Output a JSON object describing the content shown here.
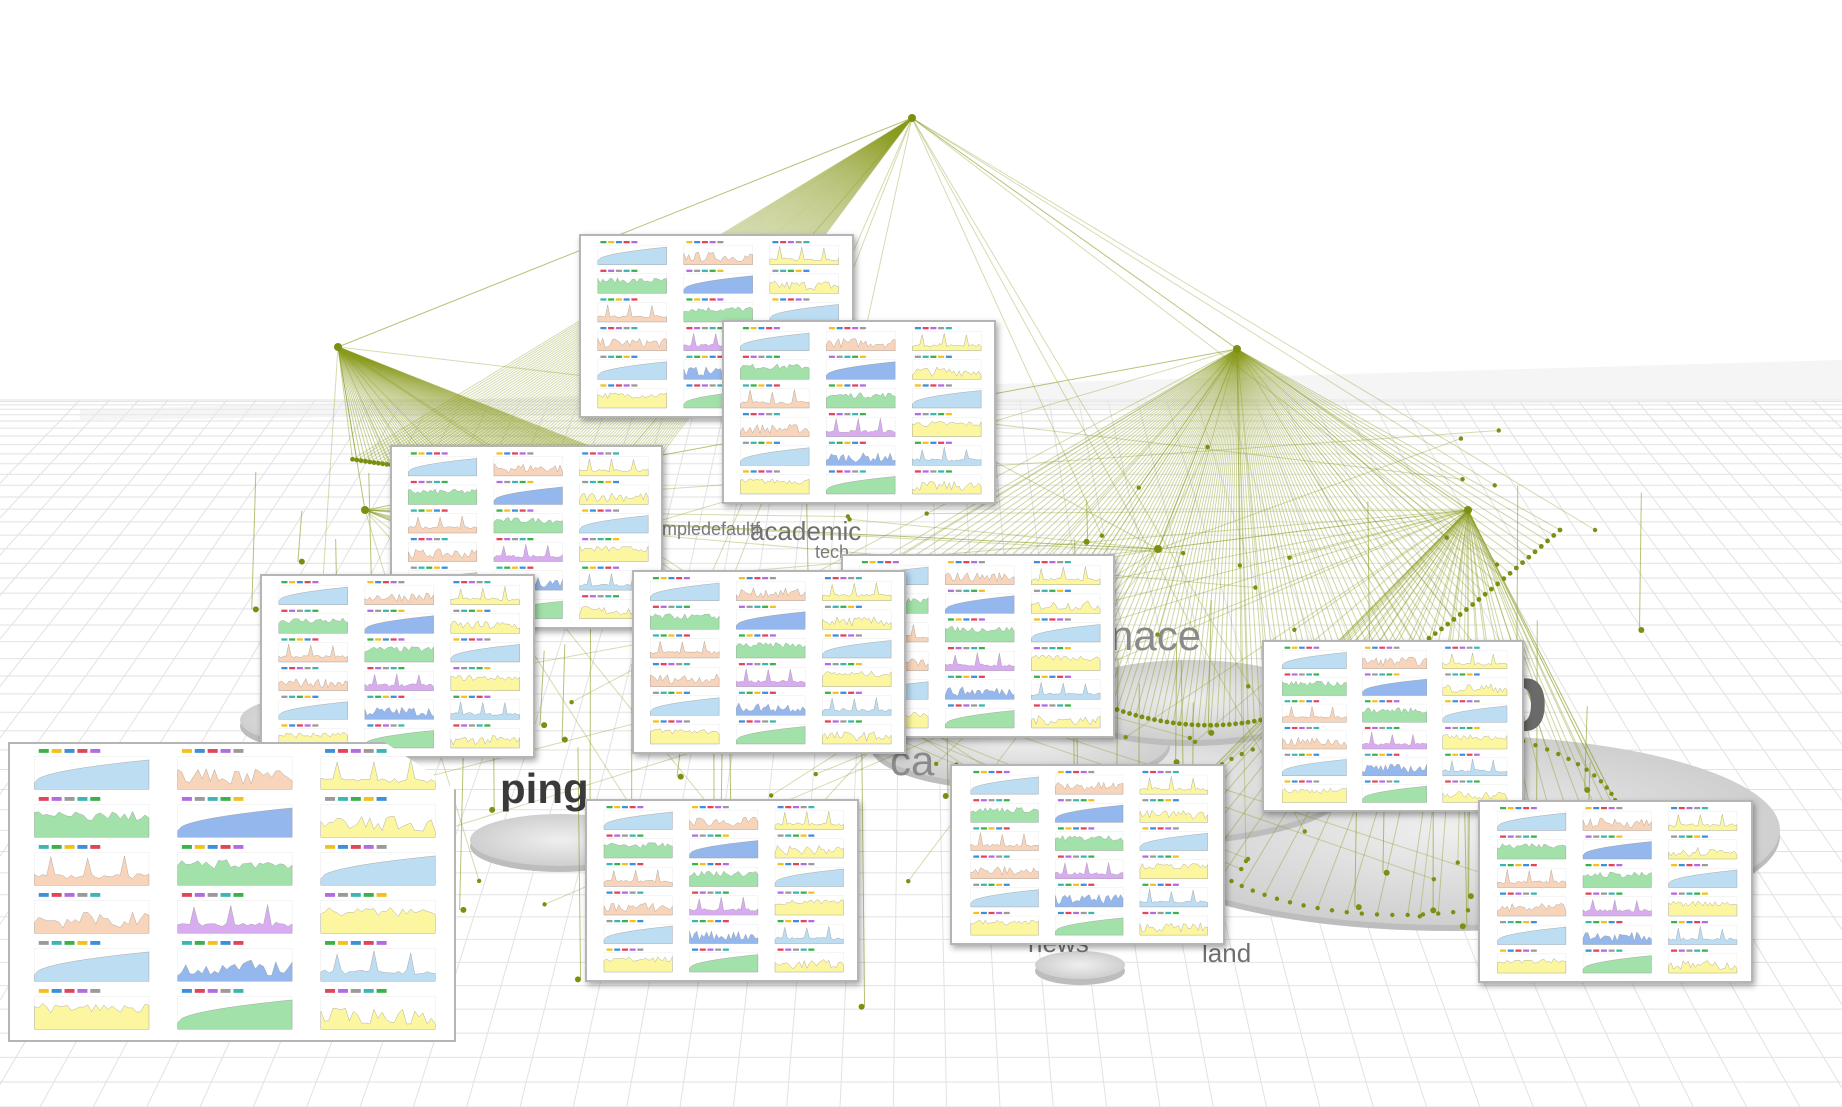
{
  "labels": [
    {
      "id": "label-b",
      "text": "b"
    },
    {
      "id": "label-nace",
      "text": "nace"
    },
    {
      "id": "label-ping",
      "text": "ping"
    },
    {
      "id": "label-ca",
      "text": "ca"
    },
    {
      "id": "label-news",
      "text": "news"
    },
    {
      "id": "label-land",
      "text": "land"
    },
    {
      "id": "label-academic",
      "text": "academic"
    },
    {
      "id": "label-entertain",
      "text": "mpledefaultf"
    },
    {
      "id": "label-tech",
      "text": "tech"
    }
  ],
  "colors": {
    "edge": "#8a9a1e",
    "node": "#7d8f12",
    "grid": "#e2e2e2",
    "disc": "#d9d9d9",
    "chart_blue_light": "#b9dcf2",
    "chart_blue": "#8fb4ee",
    "chart_peach": "#f8d3b7",
    "chart_yellow": "#fbf69a",
    "chart_green": "#9fe0a6",
    "chart_purple": "#d7a8f2",
    "legend_chips": [
      "#3bb14a",
      "#f3c01c",
      "#3c8fd8",
      "#e0455a",
      "#b36ae2",
      "#9a9a9a",
      "#3cb6b2"
    ]
  },
  "panels": [
    {
      "id": "panel-1"
    },
    {
      "id": "panel-2"
    },
    {
      "id": "panel-3"
    },
    {
      "id": "panel-4"
    },
    {
      "id": "panel-5"
    },
    {
      "id": "panel-6"
    },
    {
      "id": "panel-7"
    },
    {
      "id": "panel-8"
    },
    {
      "id": "panel-9"
    },
    {
      "id": "panel-10"
    },
    {
      "id": "panel-11"
    }
  ]
}
